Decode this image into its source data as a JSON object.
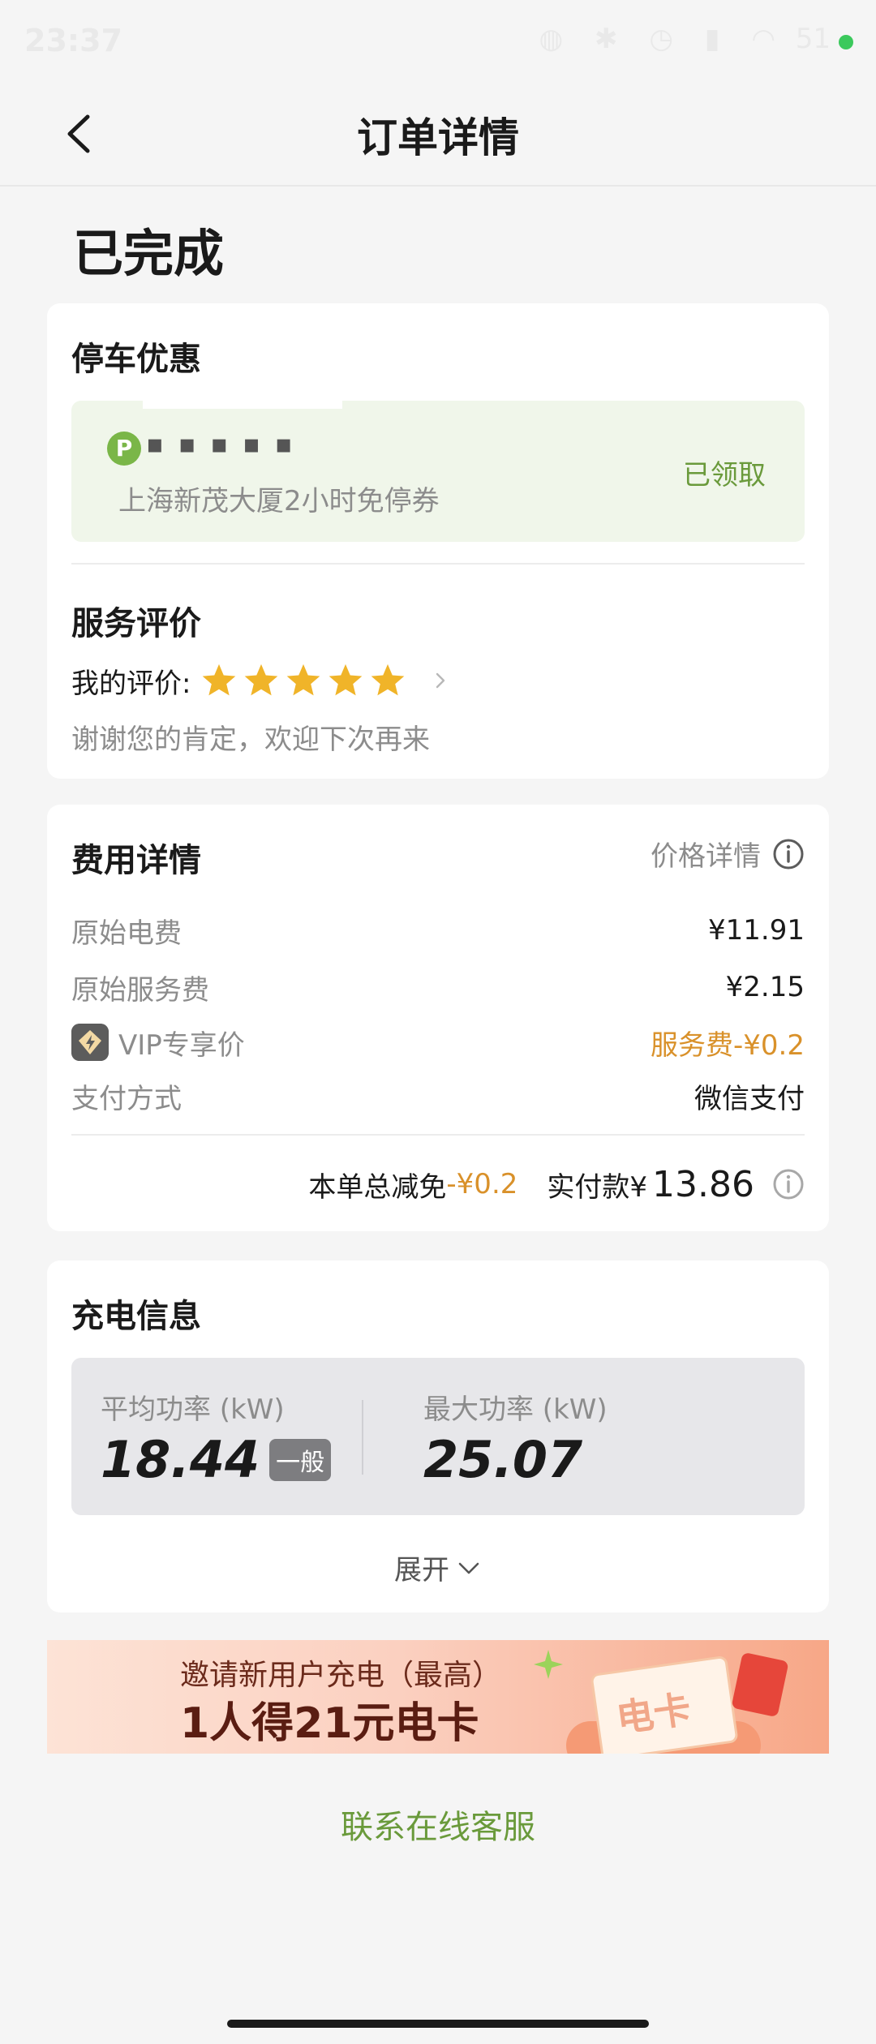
{
  "status_bar": {
    "time": "23:37",
    "icons": [
      "nfc-icon",
      "bluetooth-icon",
      "alarm-icon",
      "signal-icon",
      "wifi-icon"
    ],
    "battery": "51"
  },
  "header": {
    "title": "订单详情"
  },
  "order": {
    "status": "已完成"
  },
  "parking": {
    "title": "停车优惠",
    "plate": "▪▪▪▪▪",
    "coupon_desc": "上海新茂大厦2小时免停券",
    "coupon_status": "已领取"
  },
  "rating": {
    "title": "服务评价",
    "label": "我的评价:",
    "stars": 5,
    "comment": "谢谢您的肯定，欢迎下次再来"
  },
  "fee": {
    "title": "费用详情",
    "price_detail": "价格详情",
    "rows": [
      {
        "label": "原始电费",
        "value": "¥11.91"
      },
      {
        "label": "原始服务费",
        "value": "¥2.15"
      },
      {
        "label": "VIP专享价",
        "value": "服务费-¥0.2"
      },
      {
        "label": "支付方式",
        "value": "微信支付"
      }
    ],
    "total_discount_label": "本单总减免",
    "total_discount_value": "-¥0.2",
    "actual_label": "实付款¥",
    "actual_value": "13.86"
  },
  "charge": {
    "title": "充电信息",
    "avg_label": "平均功率 (kW)",
    "avg_value": "18.44",
    "avg_badge": "一般",
    "max_label": "最大功率 (kW)",
    "max_value": "25.07",
    "expand_label": "展开"
  },
  "promo": {
    "line1": "邀请新用户充电（最高）",
    "line2": "1人得21元电卡",
    "card_text": "电卡"
  },
  "footer": {
    "contact": "联系在线客服"
  },
  "colors": {
    "accent_green": "#6a9a3b",
    "accent_orange": "#d9912a",
    "star": "#f0b429"
  }
}
